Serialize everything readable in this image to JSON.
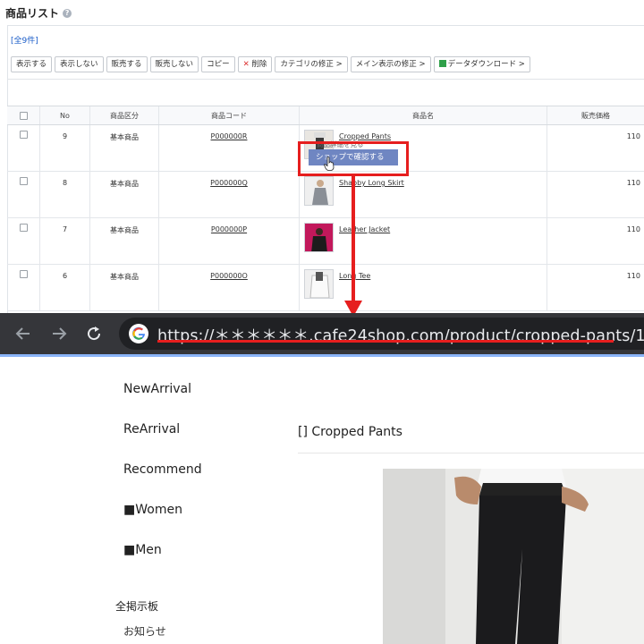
{
  "admin": {
    "title": "商品リスト",
    "count_label": "[全9件]",
    "toolbar": {
      "show": "表示する",
      "hide": "表示しない",
      "sell": "販売する",
      "nosell": "販売しない",
      "copy": "コピー",
      "delete": "削除",
      "category_edit": "カテゴリの修正 >",
      "main_display_edit": "メイン表示の修正 >",
      "data_download": "データダウンロード >"
    },
    "columns": {
      "no": "No",
      "type": "商品区分",
      "code": "商品コード",
      "name": "商品名",
      "price": "販売価格"
    },
    "rows": [
      {
        "no": "9",
        "type": "基本商品",
        "code": "P000000R",
        "name": "Cropped Pants",
        "price": "110"
      },
      {
        "no": "8",
        "type": "基本商品",
        "code": "P000000Q",
        "name": "Shabby Long Skirt",
        "price": "110"
      },
      {
        "no": "7",
        "type": "基本商品",
        "code": "P000000P",
        "name": "Leather Jacket",
        "price": "110"
      },
      {
        "no": "6",
        "type": "基本商品",
        "code": "P000000O",
        "name": "Long Tee",
        "price": "110"
      }
    ],
    "context_menu": {
      "ghost_label": "商品詳細を見る",
      "highlighted": "ショップで確認する"
    }
  },
  "browser": {
    "url": "https://＊＊＊＊＊＊.cafe24shop.com/product/cropped-pants/17/"
  },
  "shop": {
    "categories": [
      "NewArrival",
      "ReArrival",
      "Recommend",
      "■Women",
      "■Men"
    ],
    "board_title": "全掲示板",
    "board_item": "お知らせ",
    "product_title": "[] Cropped Pants"
  },
  "colors": {
    "highlight": "#e61e1e",
    "menu": "#6f86c2",
    "browser_bar": "#35363a",
    "link_blue": "#1a5cc8"
  }
}
